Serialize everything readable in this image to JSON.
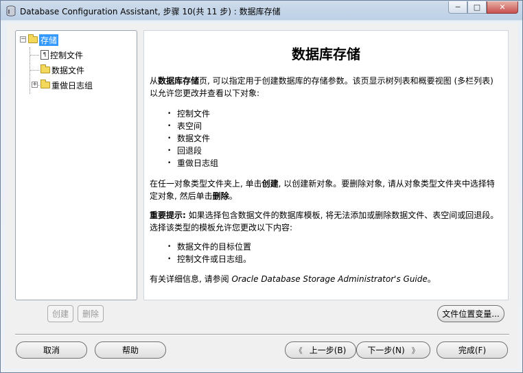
{
  "window": {
    "title": "Database Configuration Assistant, 步骤 10(共 11 步) : 数据库存储",
    "controls": {
      "minimize": "─",
      "maximize": "□",
      "close": "✕"
    }
  },
  "tree": {
    "root": {
      "label": "存储",
      "expander": "−"
    },
    "children": [
      {
        "label": "控制文件",
        "icon": "control-file-icon"
      },
      {
        "label": "数据文件",
        "icon": "folder-icon"
      },
      {
        "label": "重做日志组",
        "icon": "folder-icon",
        "expander": "+"
      }
    ]
  },
  "tree_buttons": {
    "create": "创建",
    "delete": "删除"
  },
  "content": {
    "heading": "数据库存储",
    "intro_prefix": "从",
    "intro_bold": "数据库存储",
    "intro_rest": "页, 可以指定用于创建数据库的存储参数。该页显示树列表和概要视图 (多栏列表) 以允许您更改并查看以下对象:",
    "objects": [
      "控制文件",
      "表空间",
      "数据文件",
      "回退段",
      "重做日志组"
    ],
    "create_p1": "在任一对象类型文件夹上, 单击",
    "create_b1": "创建",
    "create_p2": ", 以创建新对象。要删除对象, 请从对象类型文件夹中选择特定对象, 然后单击",
    "create_b2": "删除",
    "create_p3": "。",
    "note_bold": "重要提示:",
    "note_rest": " 如果选择包含数据文件的数据库模板, 将无法添加或删除数据文件、表空间或回退段。选择该类型的模板允许您更改以下内容:",
    "changes": [
      "数据文件的目标位置",
      "控制文件或日志组。"
    ],
    "ref_prefix": "有关详细信息, 请参阅 ",
    "ref_italic": "Oracle Database Storage Administrator's Guide",
    "ref_suffix": "。"
  },
  "file_location_button": "文件位置变量...",
  "bottom": {
    "cancel": "取消",
    "help": "帮助",
    "back": "上一步(B)",
    "next": "下一步(N)",
    "finish": "完成(F)",
    "back_arrow": "《",
    "next_arrow": "》"
  }
}
